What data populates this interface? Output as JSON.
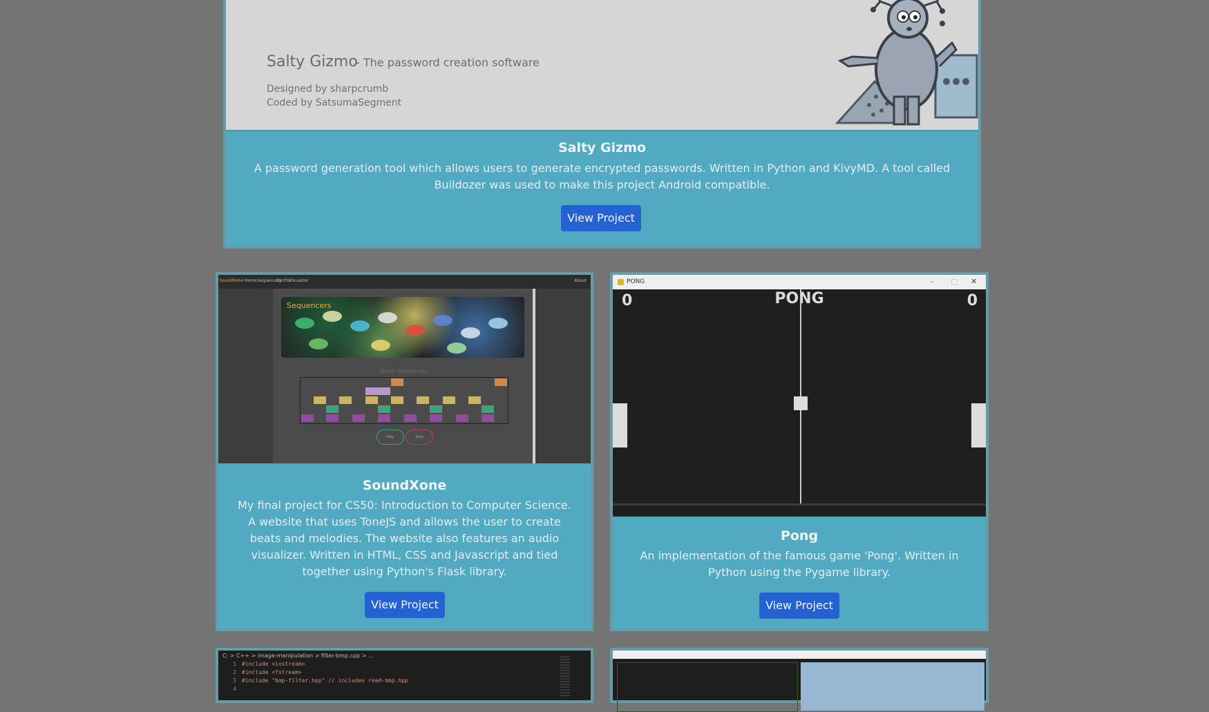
{
  "salty": {
    "screenshot": {
      "name": "Salty Gizmo",
      "tagline": "- The password creation software",
      "designed_by": "Designed by sharpcrumb",
      "coded_by": "Coded by SatsumaSegment"
    },
    "title": "Salty Gizmo",
    "description": "A password generation tool which allows users to generate encrypted passwords. Written in Python and KivyMD. A tool called Buildozer was used to make this project Android compatible.",
    "button": "View Project"
  },
  "soundxone": {
    "screenshot": {
      "brand": "SoundXone",
      "nav": [
        "Home",
        "Sequencers",
        "Synths",
        "Visualizer"
      ],
      "nav_right": "About",
      "banner_title": "Sequencers",
      "grid_title": "Drum Sequencer",
      "play": "Play",
      "stop": "Stop"
    },
    "title": "SoundXone",
    "description": "My final project for CS50: Introduction to Computer Science. A website that uses ToneJS and allows the user to create beats and melodies. The website also features an audio visualizer. Written in HTML, CSS and Javascript and tied together using Python's Flask library.",
    "button": "View Project"
  },
  "pong": {
    "screenshot": {
      "window_title": "PONG",
      "heading": "PONG",
      "score_left": "0",
      "score_right": "0"
    },
    "title": "Pong",
    "description": "An implementation of the famous game 'Pong'. Written in Python using the Pygame library.",
    "button": "View Project"
  },
  "code_preview": {
    "breadcrumb": "C: > C++ > image-manipulation > filter-bmp.cpp > ...",
    "lines": [
      {
        "n": "1",
        "text": "#include <iostream>"
      },
      {
        "n": "2",
        "text": "#include <fstream>"
      },
      {
        "n": "3",
        "text": "#include \"bmp-filter.hpp\" // includes read-bmp.hpp"
      },
      {
        "n": "4",
        "text": ""
      }
    ]
  },
  "colors": {
    "card_bg": "#52a9c2",
    "button_bg": "#2462d4",
    "page_bg": "#747474"
  }
}
